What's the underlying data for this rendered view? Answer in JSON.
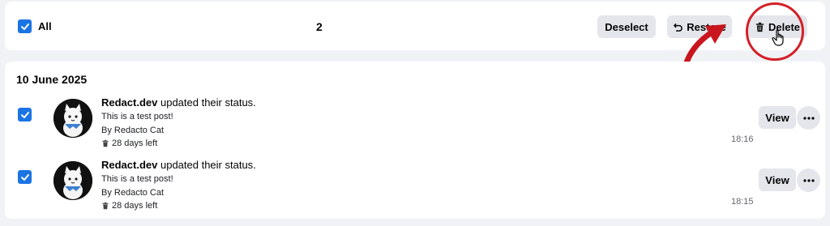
{
  "toolbar": {
    "select_all_label": "All",
    "selected_count": "2",
    "deselect_label": "Deselect",
    "restore_label": "Restore",
    "delete_label": "Delete"
  },
  "list": {
    "date": "10 June 2025",
    "items": [
      {
        "name": "Redact.dev",
        "action": " updated their status.",
        "text": "This is a test post!",
        "by": "By Redacto Cat",
        "days_left": "28 days left",
        "time": "18:16",
        "view_label": "View"
      },
      {
        "name": "Redact.dev",
        "action": " updated their status.",
        "text": "This is a test post!",
        "by": "By Redacto Cat",
        "days_left": "28 days left",
        "time": "18:15",
        "view_label": "View"
      }
    ]
  },
  "colors": {
    "accent": "#1b74e4",
    "button_bg": "#e4e6eb",
    "annotation": "#d32027",
    "background": "#f0f2f5"
  },
  "icons": [
    "check-icon",
    "restore-icon",
    "trash-icon",
    "more-icon",
    "hand-cursor-icon"
  ]
}
